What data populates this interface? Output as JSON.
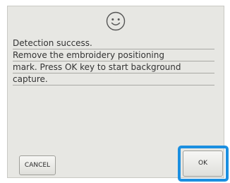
{
  "dialog": {
    "icon": "smiley-face-icon",
    "message_lines": [
      "Detection success.",
      "Remove the embroidery positioning",
      "mark. Press OK key to start background",
      "capture."
    ],
    "cancel_label": "CANCEL",
    "ok_label": "OK",
    "highlight_color": "#1b8fe0"
  }
}
